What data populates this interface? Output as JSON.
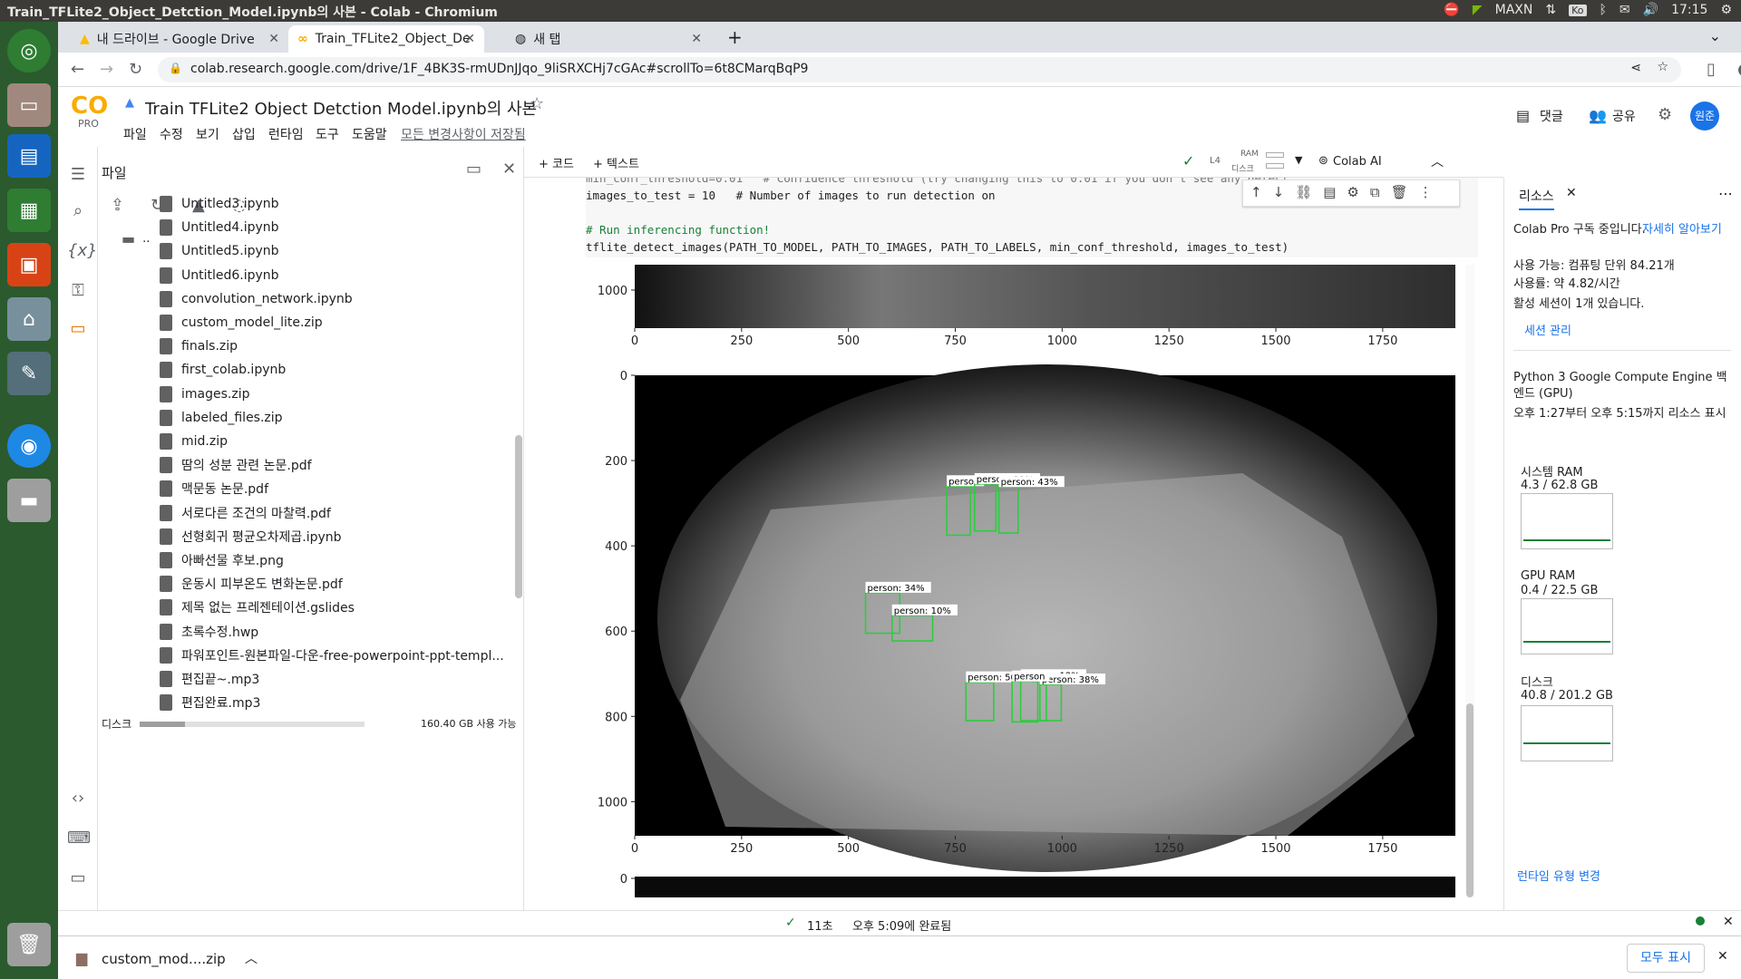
{
  "os": {
    "window_title": "Train_TFLite2_Object_Detction_Model.ipynb의 사본 - Colab - Chromium",
    "tray_maxn": "MAXN",
    "tray_lang": "Ko",
    "clock": "17:15"
  },
  "tabs": [
    {
      "label": "내 드라이브 - Google Drive"
    },
    {
      "label": "Train_TFLite2_Object_De"
    },
    {
      "label": "새 탭"
    }
  ],
  "address": {
    "url": "colab.research.google.com/drive/1F_4BK3S-rmUDnJJqo_9liSRXCHj7cGAc#scrollTo=6t8CMarqBqP9"
  },
  "colab": {
    "logo": "CO",
    "pro": "PRO",
    "notebook_title": "Train TFLite2 Object Detction Model.ipynb의 사본",
    "menu": [
      "파일",
      "수정",
      "보기",
      "삽입",
      "런타임",
      "도구",
      "도움말"
    ],
    "saved": "모든 변경사항이 저장됨",
    "comment": "댓글",
    "share": "공유",
    "avatar": "원준",
    "add_code": "+ 코드",
    "add_text": "+ 텍스트",
    "runtime_l4": "L4",
    "ram_label": "RAM",
    "disk_label": "디스크",
    "colab_ai": "Colab AI"
  },
  "files_panel": {
    "title": "파일",
    "parent": "..",
    "items": [
      "Untitled3.ipynb",
      "Untitled4.ipynb",
      "Untitled5.ipynb",
      "Untitled6.ipynb",
      "convolution_network.ipynb",
      "custom_model_lite.zip",
      "finals.zip",
      "first_colab.ipynb",
      "images.zip",
      "labeled_files.zip",
      "mid.zip",
      "땀의 성분 관련 논문.pdf",
      "맥문동 논문.pdf",
      "서로다른 조건의 마찰력.pdf",
      "선형회귀 평균오차제곱.ipynb",
      "아빠선물 후보.png",
      "운동시 피부온도 변화논문.pdf",
      "제목 없는 프레젠테이션.gslides",
      "초록수정.hwp",
      "파워포인트-원본파일-다운-free-powerpoint-ppt-templ...",
      "편집끝~.mp3",
      "편집완료.mp3"
    ],
    "disk_label": "디스크",
    "disk_free": "160.40 GB 사용 가능",
    "disk_used_fraction": 0.2
  },
  "code": {
    "line1": "min_conf_threshold=0.01   # Confidence threshold (try changing this to 0.01 if you don't see any detect",
    "line2": "images_to_test = 10   # Number of images to run detection on",
    "line3": "",
    "line4": "# Run inferencing function!",
    "line5": "tflite_detect_images(PATH_TO_MODEL, PATH_TO_IMAGES, PATH_TO_LABELS, min_conf_threshold, images_to_test)"
  },
  "plot": {
    "x_ticks": [
      "0",
      "250",
      "500",
      "750",
      "1000",
      "1250",
      "1500",
      "1750"
    ],
    "y_ticks_top": [
      "1000"
    ],
    "y_ticks_main": [
      "0",
      "200",
      "400",
      "600",
      "800",
      "1000"
    ],
    "y_tick_next": "0",
    "detections": [
      {
        "label": "person",
        "x": 730,
        "y": 260,
        "w": 55,
        "h": 115
      },
      {
        "label": "person: 33%",
        "x": 795,
        "y": 255,
        "w": 50,
        "h": 110
      },
      {
        "label": "person: 43%",
        "x": 852,
        "y": 262,
        "w": 45,
        "h": 108
      },
      {
        "label": "person: 34%",
        "x": 540,
        "y": 510,
        "w": 80,
        "h": 95
      },
      {
        "label": "person: 10%",
        "x": 602,
        "y": 563,
        "w": 95,
        "h": 60
      },
      {
        "label": "person: 50%",
        "x": 775,
        "y": 720,
        "w": 65,
        "h": 90
      },
      {
        "label": "person: 12%",
        "x": 903,
        "y": 715,
        "w": 60,
        "h": 95
      },
      {
        "label": "person: 38%",
        "x": 948,
        "y": 725,
        "w": 50,
        "h": 85
      },
      {
        "label": "person",
        "x": 883,
        "y": 718,
        "w": 60,
        "h": 95
      }
    ]
  },
  "resources": {
    "tab_label": "리소스",
    "pro_text": "Colab Pro 구독 중입니다.",
    "learn_more": "자세히 알아보기",
    "units": "사용 가능: 컴퓨팅 단위 84.21개",
    "rate": "사용률: 약 4.82/시간",
    "sessions": "활성 세션이 1개 있습니다.",
    "manage": "세션 관리",
    "backend": "Python 3 Google Compute Engine 백엔드 (GPU)",
    "time": "오후 1:27부터 오후 5:15까지 리소스 표시",
    "sys_ram_label": "시스템 RAM",
    "sys_ram_value": "4.3 / 62.8 GB",
    "gpu_ram_label": "GPU RAM",
    "gpu_ram_value": "0.4 / 22.5 GB",
    "disk_label": "디스크",
    "disk_value": "40.8 / 201.2 GB",
    "change_runtime": "런타임 유형 변경"
  },
  "status": {
    "elapsed": "11초",
    "completed": "오후 5:09에 완료됨"
  },
  "download": {
    "file": "custom_mod....zip",
    "show_all": "모두 표시"
  }
}
